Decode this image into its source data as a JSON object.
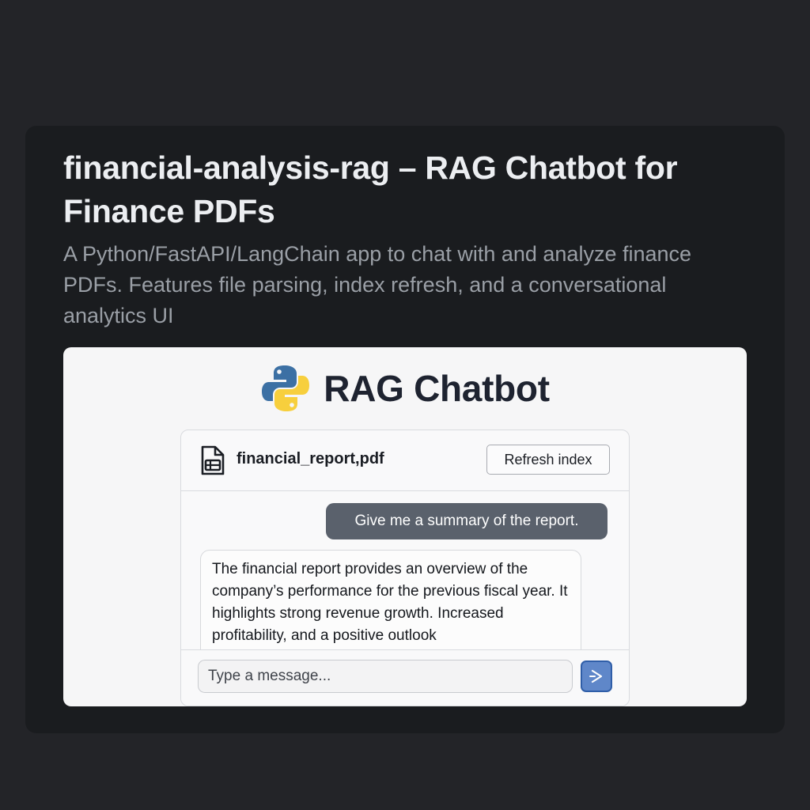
{
  "card": {
    "title": "financial-analysis-rag – RAG Chatbot for Finance PDFs",
    "description": "A Python/FastAPI/LangChain app to chat with and analyze finance PDFs. Features file parsing, index refresh, and a conversational analytics UI"
  },
  "app": {
    "title": "RAG Chatbot",
    "logo_icon": "python-logo-icon",
    "file": {
      "name": "financial_report,pdf",
      "icon": "file-document-icon"
    },
    "refresh_label": "Refresh index",
    "messages": [
      {
        "role": "user",
        "text": "Give me a summary of the report."
      },
      {
        "role": "assistant",
        "text": "The financial report provides an overview of the company’s performance for the previous fiscal year. It highlights strong revenue growth. Increased profitability, and a positive outlook"
      }
    ],
    "input": {
      "placeholder": "Type a message...",
      "value": ""
    },
    "send_icon": "send-arrow-icon"
  },
  "colors": {
    "page_bg": "#232428",
    "card_bg": "#1a1c1f",
    "user_bubble": "#5a616c",
    "send_button": "#5f87c9"
  }
}
